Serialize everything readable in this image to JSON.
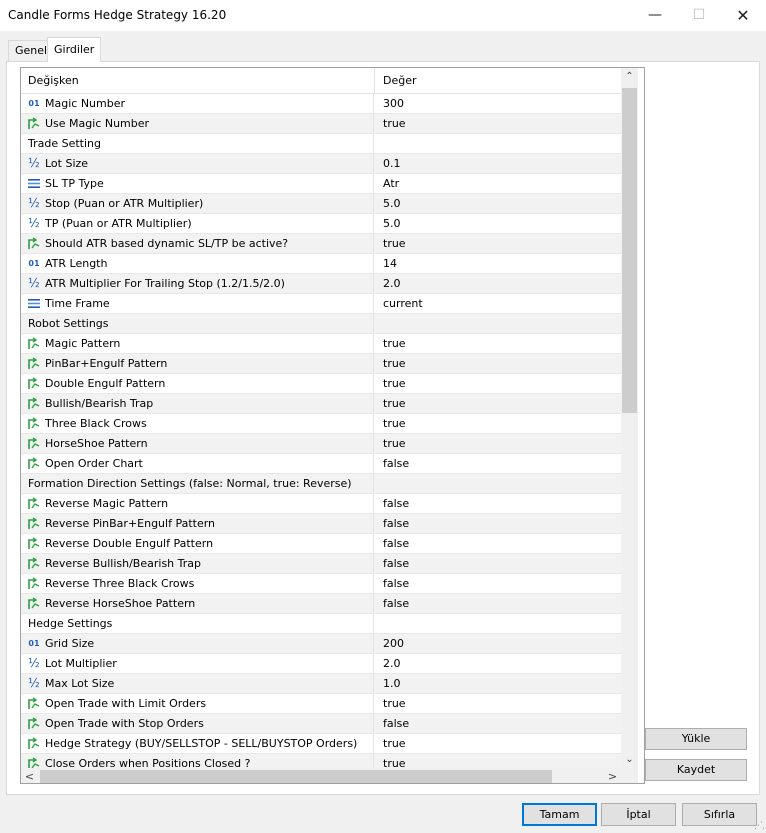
{
  "window": {
    "title": "Candle Forms Hedge Strategy 16.20",
    "minimize_glyph": "—",
    "maximize_glyph": "☐",
    "close_glyph": "✕"
  },
  "tabs": [
    {
      "label": "Genel",
      "active": false
    },
    {
      "label": "Girdiler",
      "active": true
    }
  ],
  "grid": {
    "columns": {
      "name": "Değişken",
      "value": "Değer"
    },
    "rows": [
      {
        "icon": "int-icon",
        "name": "Magic Number",
        "value": "300"
      },
      {
        "icon": "bool-icon",
        "name": "Use Magic Number",
        "value": "true"
      },
      {
        "icon": "",
        "name": "Trade Setting",
        "value": ""
      },
      {
        "icon": "double-icon",
        "name": "Lot Size",
        "value": "0.1"
      },
      {
        "icon": "list-icon",
        "name": "SL TP Type",
        "value": "Atr"
      },
      {
        "icon": "double-icon",
        "name": "Stop (Puan or ATR Multiplier)",
        "value": "5.0"
      },
      {
        "icon": "double-icon",
        "name": "TP   (Puan or ATR Multiplier)",
        "value": "5.0"
      },
      {
        "icon": "bool-icon",
        "name": "Should ATR based dynamic SL/TP be active?",
        "value": "true"
      },
      {
        "icon": "int-icon",
        "name": "ATR Length",
        "value": "14"
      },
      {
        "icon": "double-icon",
        "name": "ATR Multiplier For Trailing Stop (1.2/1.5/2.0)",
        "value": "2.0"
      },
      {
        "icon": "list-icon",
        "name": "Time Frame",
        "value": "current"
      },
      {
        "icon": "",
        "name": "Robot Settings",
        "value": ""
      },
      {
        "icon": "bool-icon",
        "name": "Magic Pattern",
        "value": "true"
      },
      {
        "icon": "bool-icon",
        "name": "PinBar+Engulf Pattern",
        "value": "true"
      },
      {
        "icon": "bool-icon",
        "name": "Double Engulf Pattern",
        "value": "true"
      },
      {
        "icon": "bool-icon",
        "name": "Bullish/Bearish Trap",
        "value": "true"
      },
      {
        "icon": "bool-icon",
        "name": "Three Black Crows",
        "value": "true"
      },
      {
        "icon": "bool-icon",
        "name": "HorseShoe Pattern",
        "value": "true"
      },
      {
        "icon": "bool-icon",
        "name": "Open Order Chart",
        "value": "false"
      },
      {
        "icon": "",
        "name": "Formation Direction Settings (false: Normal, true: Reverse)",
        "value": ""
      },
      {
        "icon": "bool-icon",
        "name": "Reverse Magic Pattern",
        "value": "false"
      },
      {
        "icon": "bool-icon",
        "name": "Reverse PinBar+Engulf Pattern",
        "value": "false"
      },
      {
        "icon": "bool-icon",
        "name": "Reverse Double Engulf Pattern",
        "value": "false"
      },
      {
        "icon": "bool-icon",
        "name": "Reverse Bullish/Bearish Trap",
        "value": "false"
      },
      {
        "icon": "bool-icon",
        "name": "Reverse Three Black Crows",
        "value": "false"
      },
      {
        "icon": "bool-icon",
        "name": "Reverse HorseShoe Pattern",
        "value": "false"
      },
      {
        "icon": "",
        "name": "Hedge Settings",
        "value": ""
      },
      {
        "icon": "int-icon",
        "name": "Grid Size",
        "value": "200"
      },
      {
        "icon": "double-icon",
        "name": "Lot Multiplier",
        "value": "2.0"
      },
      {
        "icon": "double-icon",
        "name": "Max Lot Size",
        "value": "1.0"
      },
      {
        "icon": "bool-icon",
        "name": "Open Trade with Limit Orders",
        "value": "true"
      },
      {
        "icon": "bool-icon",
        "name": "Open Trade with Stop Orders",
        "value": "false"
      },
      {
        "icon": "bool-icon",
        "name": "Hedge Strategy (BUY/SELLSTOP - SELL/BUYSTOP Orders)",
        "value": "true"
      },
      {
        "icon": "bool-icon",
        "name": "Close Orders when Positions Closed ?",
        "value": "true"
      }
    ]
  },
  "scroll_glyphs": {
    "up": "⌃",
    "down": "⌄",
    "left": "<",
    "right": ">"
  },
  "side_buttons": {
    "load": "Yükle",
    "save": "Kaydet"
  },
  "footer_buttons": {
    "ok": "Tamam",
    "cancel": "İptal",
    "reset": "Sıfırla"
  },
  "icon_glyphs": {
    "int": "01",
    "double": "½"
  },
  "colors": {
    "icon_blue": "#1f5fb8",
    "icon_green": "#2ea043",
    "focus_blue": "#0078d7"
  }
}
